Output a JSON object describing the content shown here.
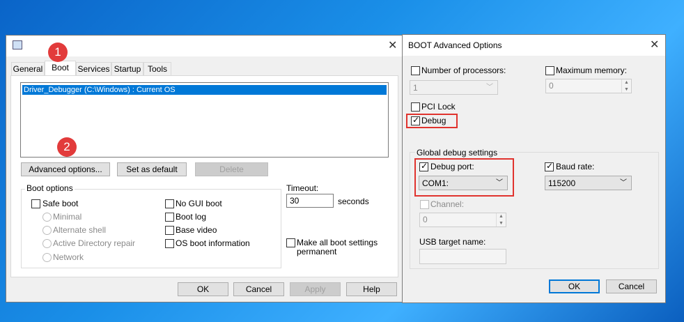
{
  "msconfig": {
    "tabs": [
      "General",
      "Boot",
      "Services",
      "Startup",
      "Tools"
    ],
    "boot_entry": "Driver_Debugger (C:\\Windows) : Current OS",
    "buttons": {
      "advanced": "Advanced options...",
      "set_default": "Set as default",
      "delete": "Delete"
    },
    "boot_options": {
      "title": "Boot options",
      "safe_boot": "Safe boot",
      "minimal": "Minimal",
      "alternate_shell": "Alternate shell",
      "ad_repair": "Active Directory repair",
      "network": "Network",
      "no_gui_boot": "No GUI boot",
      "boot_log": "Boot log",
      "base_video": "Base video",
      "os_boot_info": "OS boot information"
    },
    "timeout": {
      "label": "Timeout:",
      "value": "30",
      "unit": "seconds"
    },
    "make_permanent_1": "Make all boot settings",
    "make_permanent_2": "permanent",
    "bottom_buttons": {
      "ok": "OK",
      "cancel": "Cancel",
      "apply": "Apply",
      "help": "Help"
    }
  },
  "advanced": {
    "title": "BOOT Advanced Options",
    "num_processors": {
      "label": "Number of processors:",
      "value": "1"
    },
    "max_memory": {
      "label": "Maximum memory:",
      "value": "0"
    },
    "pci_lock": "PCI Lock",
    "debug": "Debug",
    "global_debug": {
      "title": "Global debug settings",
      "debug_port_label": "Debug port:",
      "debug_port_value": "COM1:",
      "baud_rate_label": "Baud rate:",
      "baud_rate_value": "115200",
      "channel_label": "Channel:",
      "channel_value": "0",
      "usb_label": "USB target name:",
      "usb_value": ""
    },
    "ok": "OK",
    "cancel": "Cancel"
  },
  "annotations": {
    "step1": "1",
    "step2": "2"
  },
  "colors": {
    "highlight": "#e0332e",
    "selection": "#0078d7"
  }
}
